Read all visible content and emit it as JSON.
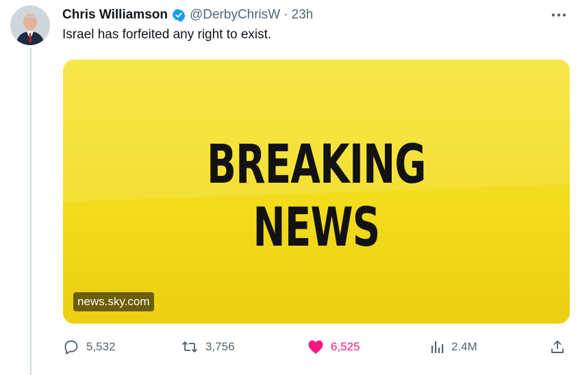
{
  "tweet": {
    "author_name": "Chris Williamson",
    "handle": "@DerbyChrisW",
    "separator": "·",
    "time": "23h",
    "text": "Israel has forfeited any right to exist.",
    "verified": true
  },
  "media": {
    "headline_line1": "BREAKING",
    "headline_line2": "NEWS",
    "source": "news.sky.com",
    "background_color": "#f2dc1c"
  },
  "actions": {
    "replies": "5,532",
    "reposts": "3,756",
    "likes": "6,525",
    "views": "2.4M"
  },
  "icons": {
    "verified": "verified-badge-icon",
    "more": "more-dots-icon",
    "reply": "reply-bubble-icon",
    "repost": "repost-icon",
    "like": "heart-icon",
    "views": "views-chart-icon",
    "share": "share-icon"
  },
  "colors": {
    "verified_blue": "#1d9bf0",
    "like_pink": "#f91880",
    "muted_gray": "#536471"
  }
}
